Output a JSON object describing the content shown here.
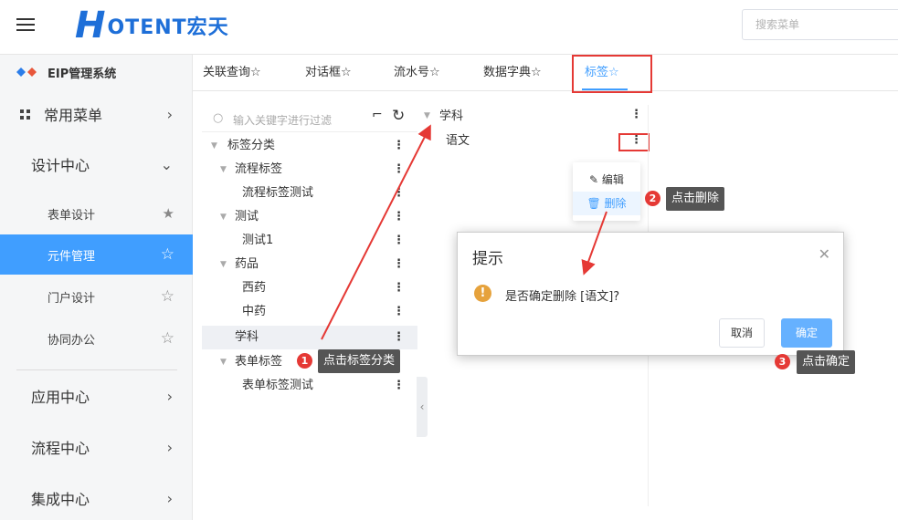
{
  "header": {
    "logo_letter": "H",
    "logo_text": "OTENT宏天",
    "search_placeholder": "搜索菜单"
  },
  "sidebar": {
    "system_title": "EIP管理系统",
    "common_menu": "常用菜单",
    "design_center": "设计中心",
    "items": [
      {
        "label": "表单设计",
        "star": "★"
      },
      {
        "label": "元件管理",
        "star": "☆"
      },
      {
        "label": "门户设计",
        "star": "☆"
      },
      {
        "label": "协同办公",
        "star": "☆"
      }
    ],
    "app_center": "应用中心",
    "flow_center": "流程中心",
    "integration_center": "集成中心"
  },
  "tabs": [
    {
      "label": "关联查询☆"
    },
    {
      "label": "对话框☆"
    },
    {
      "label": "流水号☆"
    },
    {
      "label": "数据字典☆"
    },
    {
      "label": "标签☆"
    }
  ],
  "tree": {
    "filter_placeholder": "输入关键字进行过滤",
    "rows": [
      {
        "label": "标签分类"
      },
      {
        "label": "流程标签"
      },
      {
        "label": "流程标签测试"
      },
      {
        "label": "测试"
      },
      {
        "label": "测试1"
      },
      {
        "label": "药品"
      },
      {
        "label": "西药"
      },
      {
        "label": "中药"
      },
      {
        "label": "学科"
      },
      {
        "label": "表单标签"
      },
      {
        "label": "表单标签测试"
      }
    ]
  },
  "right_tree": {
    "parent": "学科",
    "child": "语文"
  },
  "context_menu": {
    "edit": "编辑",
    "delete": "删除"
  },
  "dialog": {
    "title": "提示",
    "message": "是否确定删除 [语文]?",
    "cancel": "取消",
    "confirm": "确定"
  },
  "annotations": [
    {
      "step": "1",
      "text": "点击标签分类"
    },
    {
      "step": "2",
      "text": "点击删除"
    },
    {
      "step": "3",
      "text": "点击确定"
    }
  ],
  "colors": {
    "brand": "#1e6fd8",
    "accent": "#409eff",
    "annotation_red": "#e53935",
    "warning": "#e6a23c"
  }
}
